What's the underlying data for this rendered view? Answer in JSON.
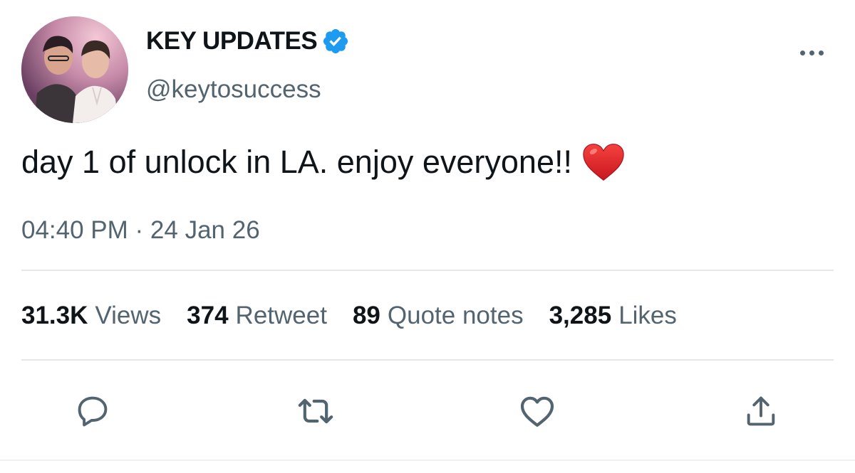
{
  "account": {
    "display_name": "KEY UPDATES",
    "handle": "@keytosuccess",
    "verified": true,
    "verified_icon": "verified-badge-icon"
  },
  "tweet": {
    "text": "day 1 of unlock in LA. enjoy everyone!!",
    "emoji": "red-heart-emoji",
    "timestamp": "04:40 PM · 24 Jan 26"
  },
  "stats": {
    "views_count": "31.3K",
    "views_label": "Views",
    "retweets_count": "374",
    "retweets_label": "Retweet",
    "quotes_count": "89",
    "quotes_label": "Quote notes",
    "likes_count": "3,285",
    "likes_label": "Likes"
  },
  "actions": [
    "reply-icon",
    "retweet-icon",
    "like-icon",
    "share-icon"
  ],
  "colors": {
    "primary_text": "#0f1419",
    "secondary_text": "#536471",
    "verified_blue": "#1d9bf0",
    "divider": "#e4e8eb",
    "heart_red": "#e0262d"
  }
}
